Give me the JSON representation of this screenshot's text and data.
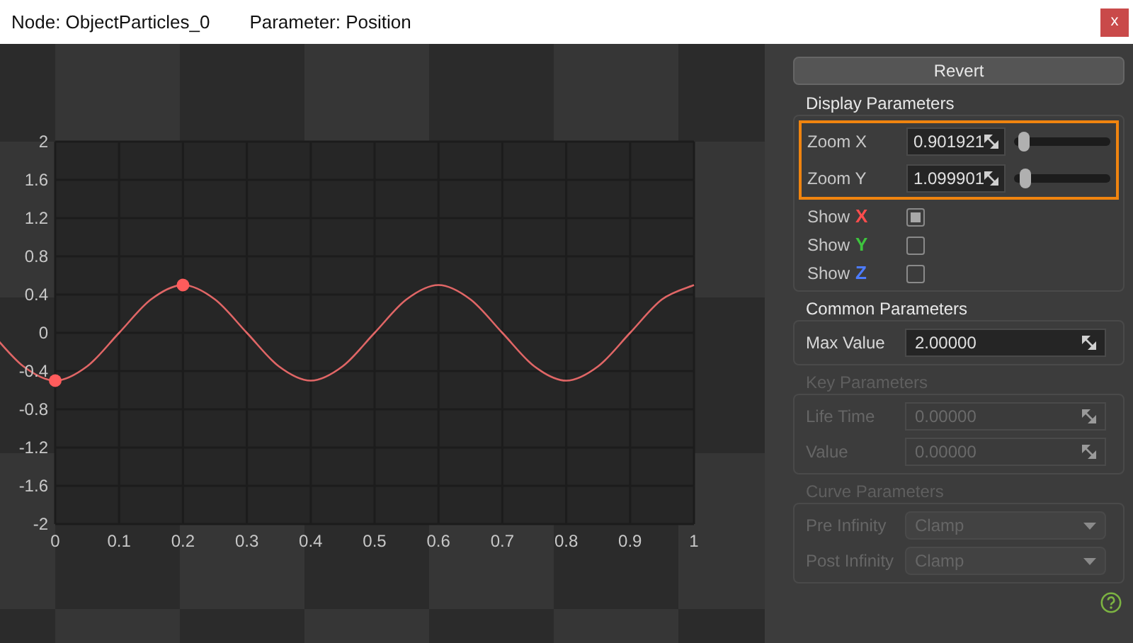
{
  "title_bar": {
    "node": "Node: ObjectParticles_0",
    "parameter": "Parameter: Position",
    "close": "x"
  },
  "graph": {
    "chart_data": {
      "type": "line",
      "x": [
        0,
        0.05,
        0.1,
        0.15,
        0.2,
        0.25,
        0.3,
        0.35,
        0.4,
        0.45,
        0.5,
        0.55,
        0.6,
        0.65,
        0.7,
        0.75,
        0.8,
        0.85,
        0.9,
        0.95,
        1
      ],
      "series": [
        {
          "type": "line",
          "color": "#e06666",
          "values": [
            -0.5,
            -0.35,
            0,
            0.35,
            0.5,
            0.35,
            0,
            -0.35,
            -0.5,
            -0.35,
            0,
            0.35,
            0.5,
            0.35,
            0,
            -0.35,
            -0.5,
            -0.35,
            0,
            0.35,
            0.5
          ]
        },
        {
          "type": "scatter",
          "color": "#ff5c5c",
          "values": [
            -0.5,
            null,
            null,
            null,
            0.5,
            null,
            null,
            null,
            null,
            null,
            null,
            null,
            null,
            null,
            null,
            null,
            null,
            null,
            null,
            null,
            null
          ]
        }
      ],
      "xlim": [
        0,
        1
      ],
      "ylim": [
        -2,
        2
      ],
      "grid": true,
      "xticks": [
        {
          "value": 0,
          "label": "0"
        },
        {
          "value": 0.1,
          "label": "0.1"
        },
        {
          "value": 0.2,
          "label": "0.2"
        },
        {
          "value": 0.3,
          "label": "0.3"
        },
        {
          "value": 0.4,
          "label": "0.4"
        },
        {
          "value": 0.5,
          "label": "0.5"
        },
        {
          "value": 0.6,
          "label": "0.6"
        },
        {
          "value": 0.7,
          "label": "0.7"
        },
        {
          "value": 0.8,
          "label": "0.8"
        },
        {
          "value": 0.9,
          "label": "0.9"
        },
        {
          "value": 1,
          "label": "1"
        }
      ],
      "yticks": [
        {
          "value": 2,
          "label": "2"
        },
        {
          "value": 1.6,
          "label": "1.6"
        },
        {
          "value": 1.2,
          "label": "1.2"
        },
        {
          "value": 0.8,
          "label": "0.8"
        },
        {
          "value": 0.4,
          "label": "0.4"
        },
        {
          "value": 0,
          "label": "0"
        },
        {
          "value": -0.4,
          "label": "-0.4"
        },
        {
          "value": -0.8,
          "label": "-0.8"
        },
        {
          "value": -1.2,
          "label": "-1.2"
        },
        {
          "value": -1.6,
          "label": "-1.6"
        },
        {
          "value": -2,
          "label": "-2"
        }
      ]
    }
  },
  "panel": {
    "revert": "Revert",
    "display": {
      "title": "Display Parameters",
      "highlighted": true,
      "zoom": [
        {
          "label": "Zoom X",
          "value": "0.901921",
          "level": 0.1
        },
        {
          "label": "Zoom Y",
          "value": "1.099901",
          "level": 0.12
        }
      ],
      "show": [
        {
          "label": "Show",
          "axis": "X",
          "color": "#ff4d4d",
          "checked": true
        },
        {
          "label": "Show",
          "axis": "Y",
          "color": "#3ec43e",
          "checked": false
        },
        {
          "label": "Show",
          "axis": "Z",
          "color": "#4d7cff",
          "checked": false
        }
      ]
    },
    "groups": [
      {
        "title": "Common Parameters",
        "disabled": false,
        "fields": [
          {
            "kind": "number",
            "label": "Max Value",
            "value": "2.00000"
          }
        ]
      },
      {
        "title": "Key Parameters",
        "disabled": true,
        "fields": [
          {
            "kind": "number",
            "label": "Life Time",
            "value": "0.00000"
          },
          {
            "kind": "number",
            "label": "Value",
            "value": "0.00000"
          }
        ]
      },
      {
        "title": "Curve Parameters",
        "disabled": true,
        "fields": [
          {
            "kind": "select",
            "label": "Pre Infinity",
            "value": "Clamp"
          },
          {
            "kind": "select",
            "label": "Post Infinity",
            "value": "Clamp"
          }
        ]
      }
    ]
  }
}
